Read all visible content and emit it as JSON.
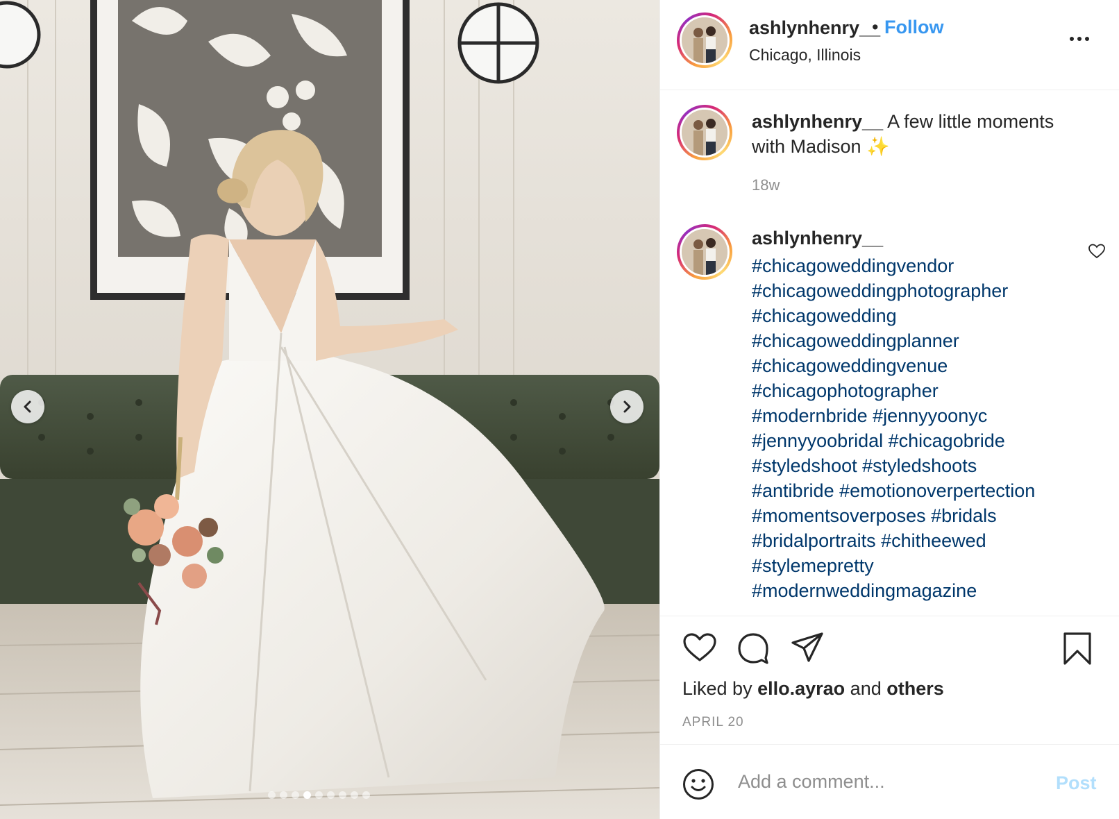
{
  "post": {
    "author": "ashlynhenry__",
    "location": "Chicago, Illinois",
    "follow_label": "Follow",
    "bullet": "•"
  },
  "caption": {
    "username": "ashlynhenry__",
    "text": "A few little moments with Madison ✨",
    "time": "18w"
  },
  "hashtag_comment": {
    "username": "ashlynhenry__",
    "lines": [
      "#chicagoweddingvendor",
      "#chicagoweddingphotographer",
      "#chicagowedding",
      "#chicagoweddingplanner",
      "#chicagoweddingvenue",
      "#chicagophotographer",
      "#modernbride #jennyyoonyc",
      "#jennyyoobridal #chicagobride",
      "#styledshoot #styledshoots",
      "#antibride #emotionoverpertection",
      "#momentsoverposes #bridals",
      "#bridalportraits #chitheewed",
      "#stylemepretty",
      "#modernweddingmagazine"
    ]
  },
  "likes": {
    "prefix": "Liked by",
    "user": "ello.ayrao",
    "middle": "and",
    "others": "others"
  },
  "date": "APRIL 20",
  "comment_form": {
    "placeholder": "Add a comment...",
    "post_label": "Post"
  },
  "carousel": {
    "slide_count": 9,
    "active_index": 3
  },
  "icons": {
    "prev": "chevron-left-icon",
    "next": "chevron-right-icon",
    "like": "heart-icon",
    "comment": "comment-bubble-icon",
    "share": "paper-plane-icon",
    "save": "bookmark-icon",
    "more": "more-horizontal-icon",
    "emoji": "smiley-icon"
  },
  "colors": {
    "link": "#3897f0",
    "hashtag": "#00376b",
    "muted": "#8e8e8e",
    "post_disabled": "#b2dffc"
  }
}
